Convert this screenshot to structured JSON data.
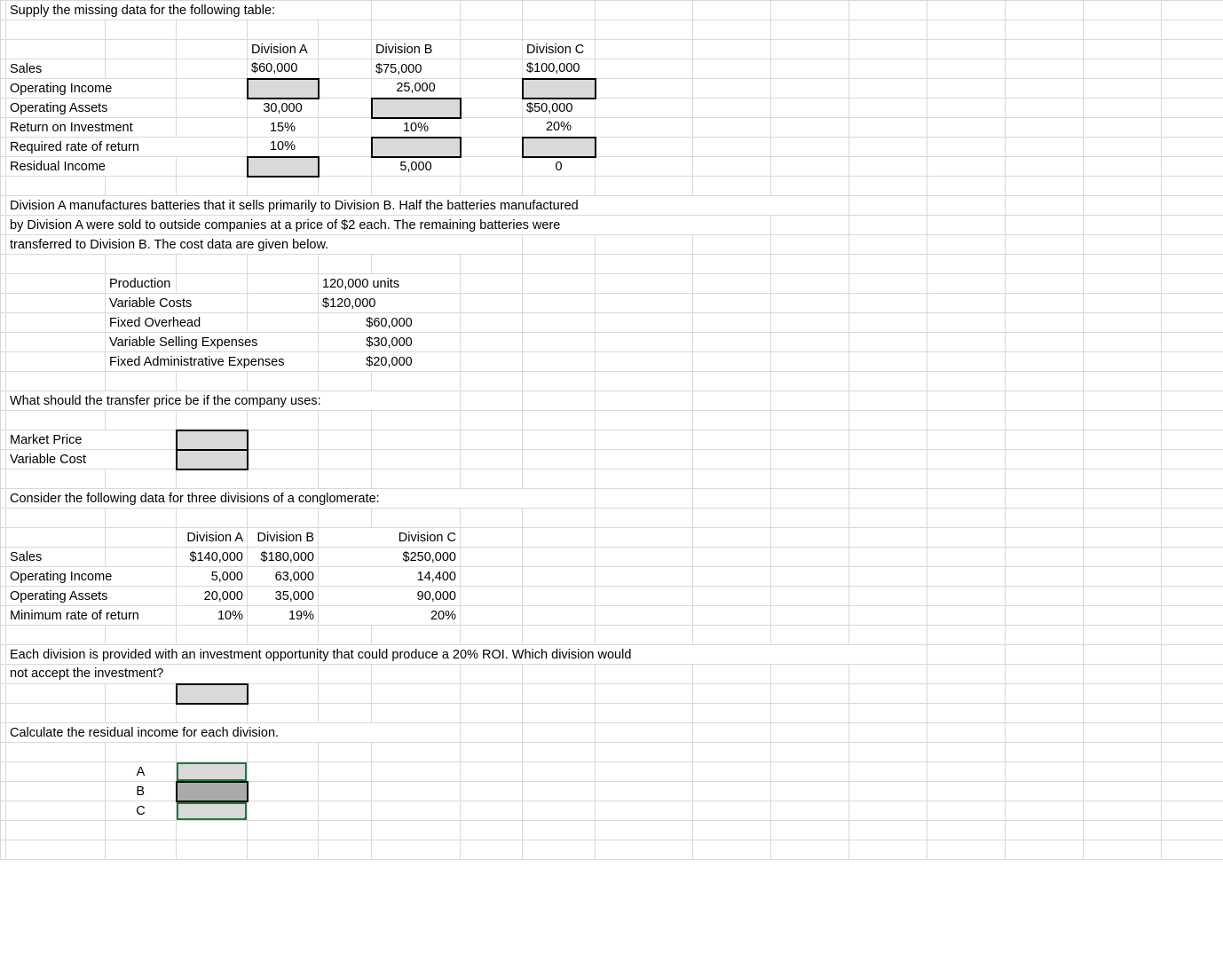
{
  "title1": "Supply the missing data for the following table:",
  "t1": {
    "hdr": {
      "a": "Division A",
      "b": "Division B",
      "c": "Division C"
    },
    "rows": {
      "sales": {
        "label": "Sales",
        "a": "$60,000",
        "b": "$75,000",
        "c": "$100,000"
      },
      "opinc": {
        "label": "Operating Income",
        "b": "25,000"
      },
      "assets": {
        "label": "Operating Assets",
        "a": "30,000",
        "c": "$50,000"
      },
      "roi": {
        "label": "Return on Investment",
        "a": "15%",
        "b": "10%",
        "c": "20%"
      },
      "req": {
        "label": "Required rate of return",
        "a": "10%"
      },
      "res": {
        "label": "Residual Income",
        "b": "5,000",
        "c": "0"
      }
    }
  },
  "para1": {
    "l1": "Division A manufactures batteries that it sells primarily to Division B. Half the batteries manufactured",
    "l2": "by Division A were sold to outside companies at a price of $2 each. The remaining batteries were",
    "l3": "transferred to Division B. The cost data are given below."
  },
  "costs": {
    "rows": [
      {
        "label": "Production",
        "val": "120,000 units"
      },
      {
        "label": "Variable Costs",
        "val": "$120,000"
      },
      {
        "label": "Fixed Overhead",
        "val": "$60,000"
      },
      {
        "label": "Variable Selling Expenses",
        "val": "$30,000"
      },
      {
        "label": "Fixed Administrative Expenses",
        "val": "$20,000"
      }
    ]
  },
  "q2": "What should the transfer price be if the company uses:",
  "q2rows": {
    "mp": "Market Price",
    "vc": "Variable Cost"
  },
  "title3": "Consider the following data for three divisions of a conglomerate:",
  "t3": {
    "hdr": {
      "a": "Division A",
      "b": "Division B",
      "c": "Division C"
    },
    "rows": {
      "sales": {
        "label": "Sales",
        "a": "$140,000",
        "b": "$180,000",
        "c": "$250,000"
      },
      "opinc": {
        "label": "Operating Income",
        "a": "5,000",
        "b": "63,000",
        "c": "14,400"
      },
      "assets": {
        "label": "Operating Assets",
        "a": "20,000",
        "b": "35,000",
        "c": "90,000"
      },
      "min": {
        "label": "Minimum rate of return",
        "a": "10%",
        "b": "19%",
        "c": "20%"
      }
    }
  },
  "para3": {
    "l1": "Each division is provided with an investment opportunity that could produce a 20% ROI. Which division would",
    "l2": "not accept the investment?"
  },
  "title4": "Calculate the residual income for each division.",
  "ri": {
    "a": "A",
    "b": "B",
    "c": "C"
  }
}
